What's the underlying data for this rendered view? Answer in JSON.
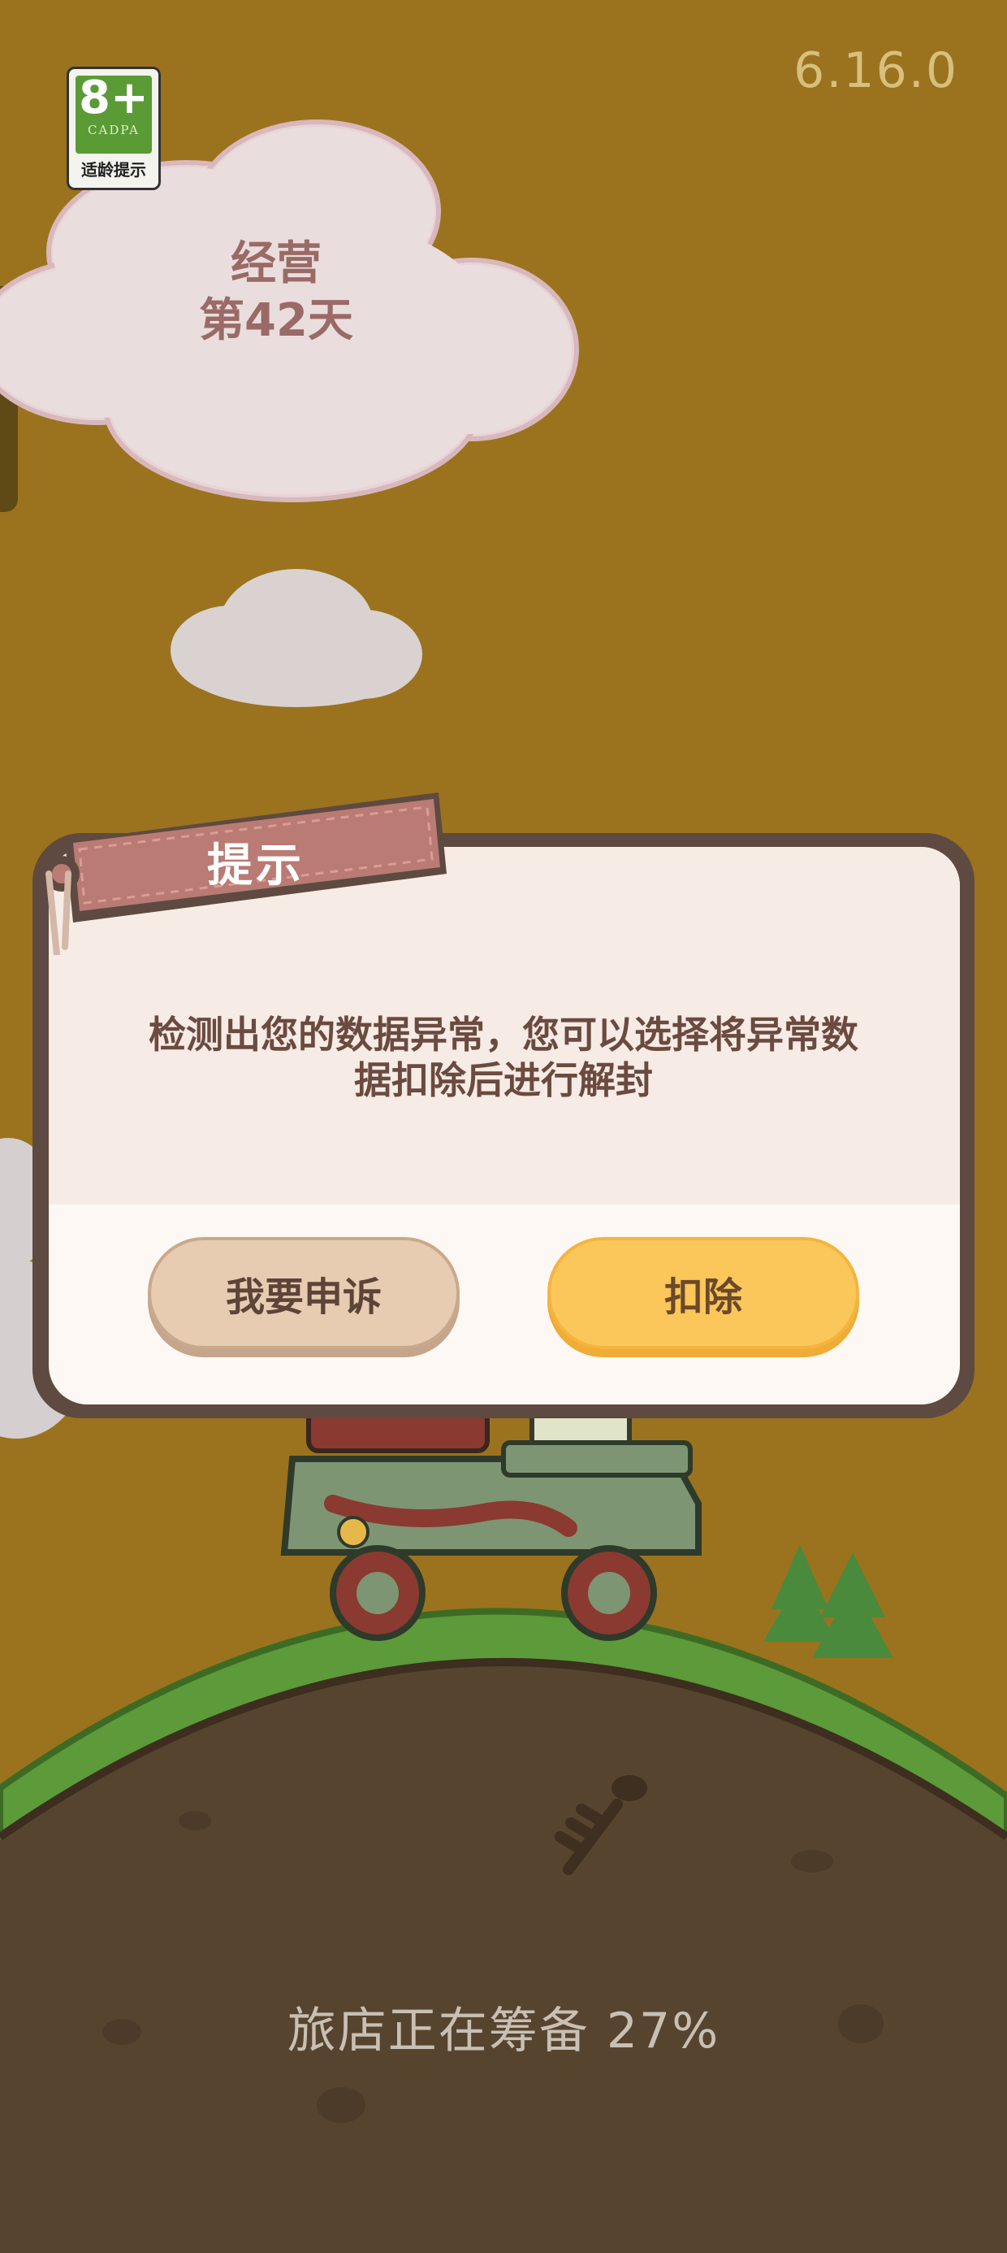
{
  "version": "6.16.0",
  "age_badge": {
    "rating": "8+",
    "org": "CADPA",
    "label": "适龄提示"
  },
  "day_counter": {
    "line1": "经营",
    "line2": "第42天"
  },
  "dialog": {
    "title": "提示",
    "message_line1": "检测出您的数据异常，您可以选择将异常数",
    "message_line2": "据扣除后进行解封",
    "appeal_label": "我要申诉",
    "deduct_label": "扣除"
  },
  "loading": {
    "text": "旅店正在筹备 27%",
    "progress_percent": 27
  },
  "colors": {
    "background": "#9b731e",
    "dialog_border": "#5e4a40",
    "primary_button": "#fbc65a",
    "secondary_button": "#e7ccb2"
  }
}
